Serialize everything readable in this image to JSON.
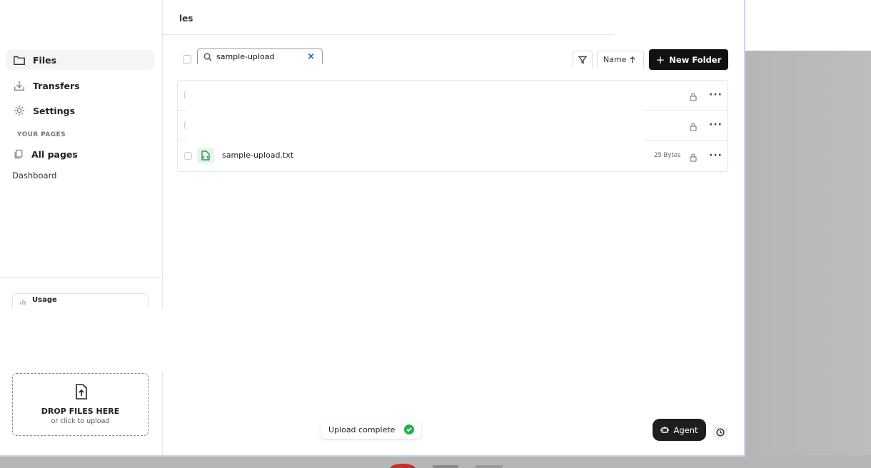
{
  "sidebar": {
    "nav": [
      {
        "label": "Files",
        "icon": "folder-icon",
        "active": true
      },
      {
        "label": "Transfers",
        "icon": "download-tray-icon",
        "active": false
      },
      {
        "label": "Settings",
        "icon": "gear-icon",
        "active": false
      }
    ],
    "section_label": "YOUR PAGES",
    "all_pages_label": "All pages",
    "dashboard_label": "Dashboard",
    "usage_title": "Usage",
    "dropzone": {
      "title": "DROP FILES HERE",
      "subtitle": "or click to upload",
      "icon": "file-upload-icon"
    }
  },
  "header": {
    "title_fragment": "les"
  },
  "toolbar": {
    "search_value": "sample-upload",
    "clear_label": "×",
    "sort_label": "Name",
    "new_folder_label": "New Folder",
    "new_folder_plus": "+"
  },
  "files": [
    {
      "name": "",
      "size": "",
      "visible": false
    },
    {
      "name": "",
      "size": "",
      "visible": false
    },
    {
      "name": "sample-upload.txt",
      "size": "25 Bytes",
      "visible": true,
      "icon": "text-file-icon"
    }
  ],
  "more_label": "···",
  "toast": {
    "label": "Upload complete"
  },
  "agent": {
    "label": "Agent"
  },
  "colors": {
    "accent": "#111111",
    "success": "#22b14c",
    "file_icon": "#2a9a4a",
    "clear": "#2060c0"
  }
}
